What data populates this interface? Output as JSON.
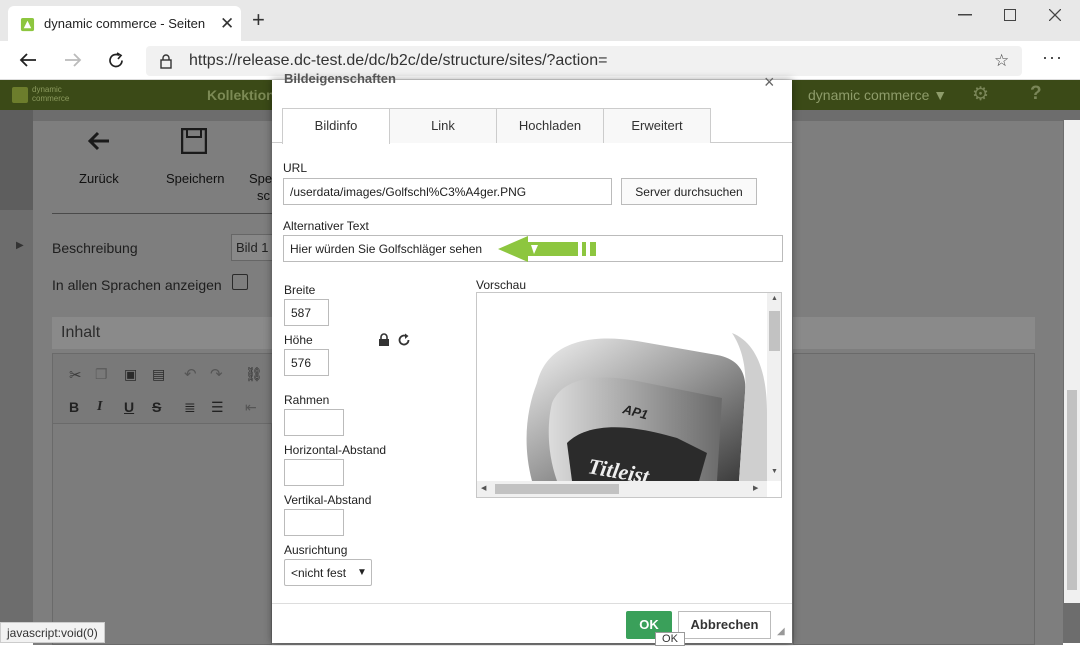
{
  "browser": {
    "tab_title": "dynamic commerce - Seiten",
    "tab_close": "✕",
    "new_tab": "+",
    "url": "https://release.dc-test.de/dc/b2c/de/structure/sites/?action=",
    "status_text": "javascript:void(0)"
  },
  "app": {
    "brand_line1": "dynamic",
    "brand_line2": "commerce",
    "nav_item": "Kollektion",
    "user_menu": "dynamic commerce ▼",
    "help": "?",
    "accent_color": "#3b4a17"
  },
  "background": {
    "toolbar": [
      "Zurück",
      "Speichern",
      "Spei",
      "sc"
    ],
    "fields": {
      "beschreibung_label": "Beschreibung",
      "beschreibung_value": "Bild 1",
      "all_languages_label": "In allen Sprachen anzeigen"
    },
    "section_title": "Inhalt"
  },
  "dialog": {
    "title": "Bildeigenschaften",
    "close": "×",
    "tabs": [
      "Bildinfo",
      "Link",
      "Hochladen",
      "Erweitert"
    ],
    "url_label": "URL",
    "url_value": "/userdata/images/Golfschl%C3%A4ger.PNG",
    "browse_button": "Server durchsuchen",
    "alt_label": "Alternativer Text",
    "alt_value": "Hier würden Sie Golfschläger sehen",
    "width_label": "Breite",
    "width_value": "587",
    "height_label": "Höhe",
    "height_value": "576",
    "border_label": "Rahmen",
    "hspace_label": "Horizontal-Abstand",
    "vspace_label": "Vertikal-Abstand",
    "align_label": "Ausrichtung",
    "align_value": "<nicht fest",
    "preview_label": "Vorschau",
    "ok_button": "OK",
    "cancel_button": "Abbrechen",
    "tooltip": "OK",
    "preview_brand": "Titleist",
    "preview_model": "AP1"
  }
}
